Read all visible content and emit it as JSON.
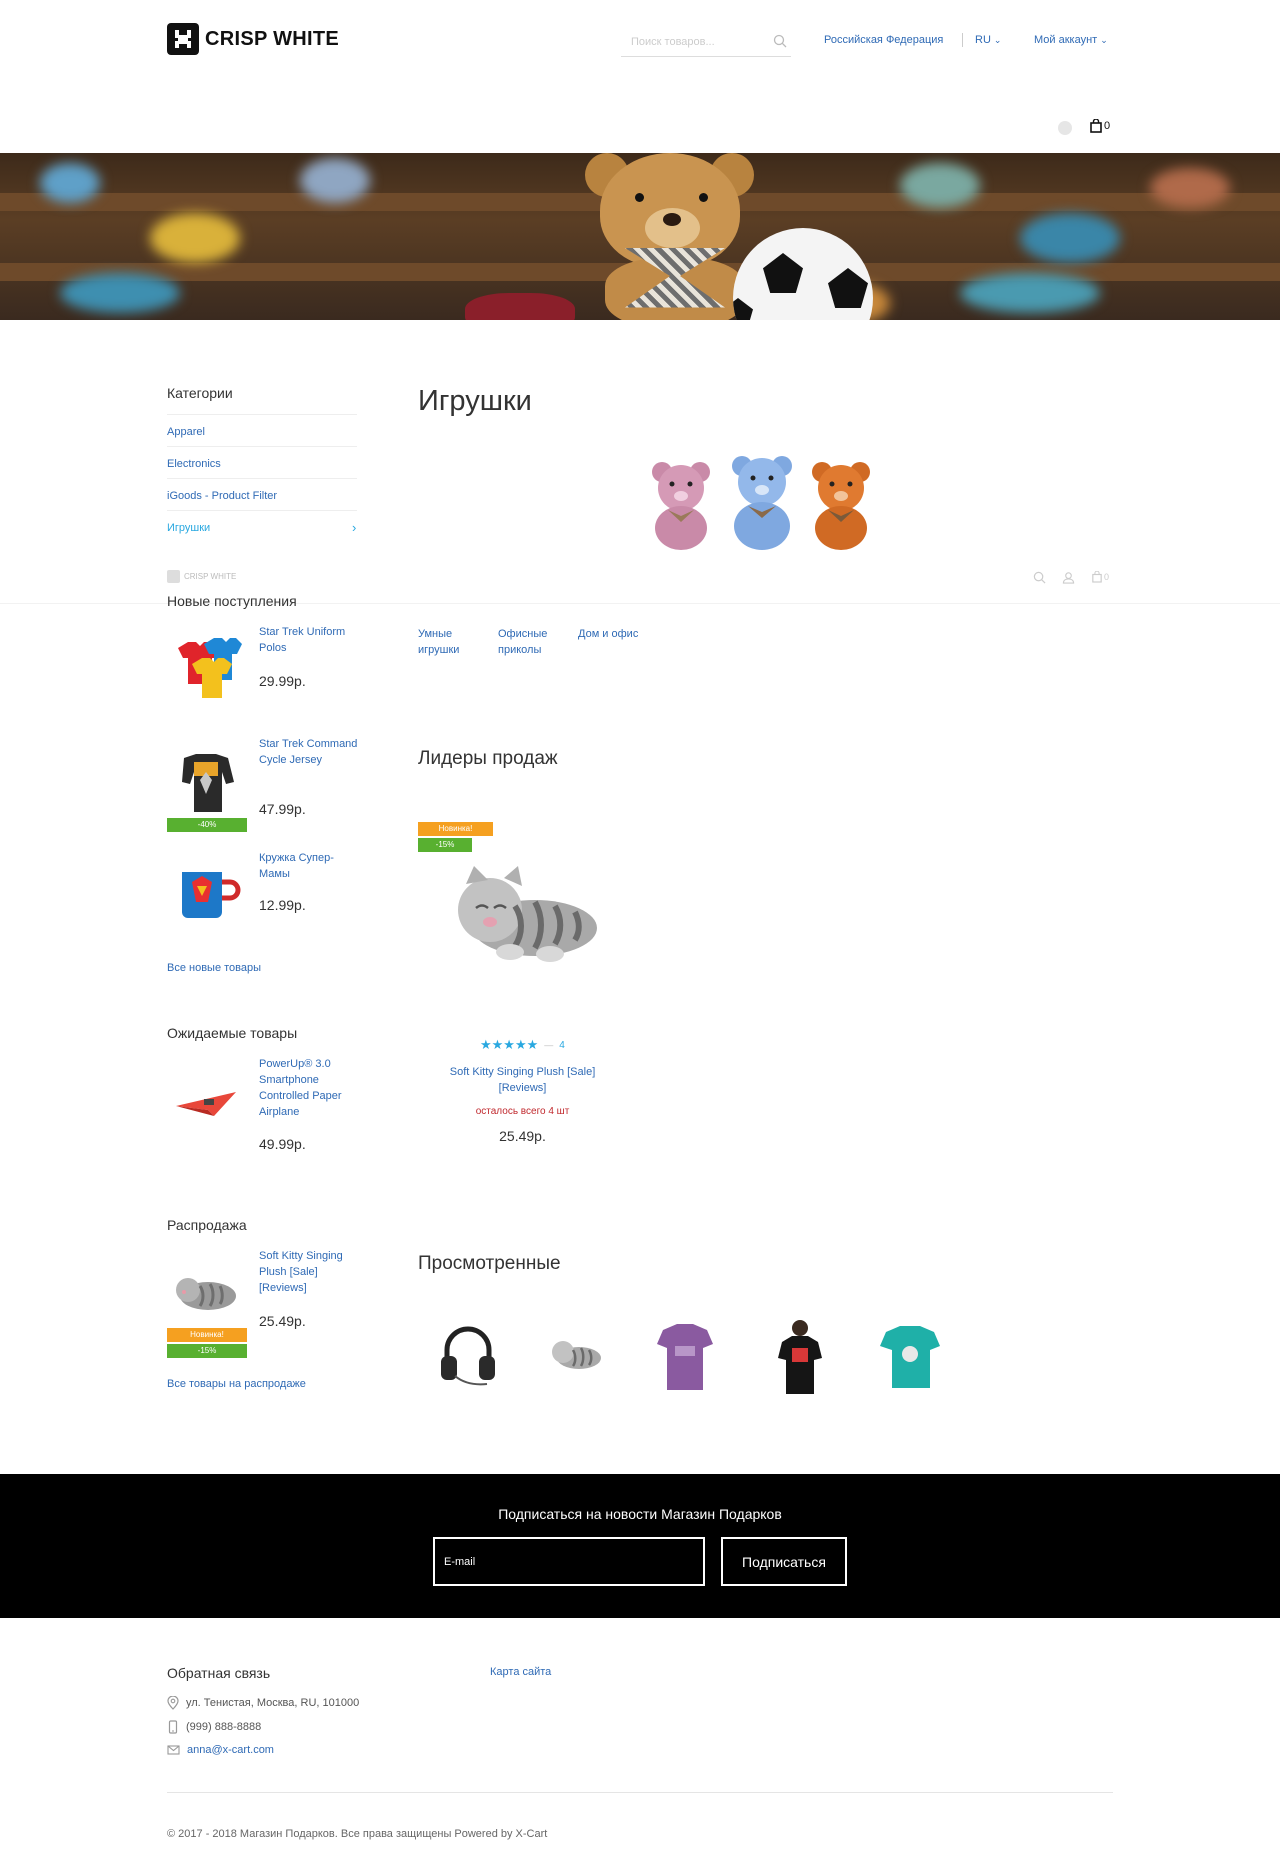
{
  "header": {
    "logo_text": "CRISP WHITE",
    "search_placeholder": "Поиск товаров...",
    "country": "Российская Федерация",
    "language": "RU",
    "account": "Мой аккаунт",
    "cart_count": "0"
  },
  "sidebar": {
    "categories_title": "Категории",
    "categories": [
      "Apparel",
      "Electronics",
      "iGoods - Product Filter",
      "Игрушки"
    ],
    "mini_logo": "CRISP WHITE",
    "new_arrivals": {
      "title": "Новые поступления",
      "items": [
        {
          "name": "Star Trek Uniform Polos",
          "price": "29.99р."
        },
        {
          "name": "Star Trek Command Cycle Jersey",
          "price": "47.99р.",
          "badge": "-40%"
        },
        {
          "name": "Кружка Супер-Мамы",
          "price": "12.99р."
        }
      ],
      "all_link": "Все новые товары"
    },
    "coming_soon": {
      "title": "Ожидаемые товары",
      "items": [
        {
          "name": "PowerUp® 3.0 Smartphone Controlled Paper Airplane",
          "price": "49.99р."
        }
      ]
    },
    "sale": {
      "title": "Распродажа",
      "items": [
        {
          "name": "Soft Kitty Singing Plush [Sale] [Reviews]",
          "price": "25.49р.",
          "badge_new": "Новинка!",
          "badge_discount": "-15%"
        }
      ],
      "all_link": "Все товары на распродаже"
    }
  },
  "main": {
    "title": "Игрушки",
    "mini_cart_count": "0",
    "subcategories": [
      "Умные игрушки",
      "Офисные приколы",
      "Дом и офис"
    ],
    "bestsellers_title": "Лидеры продаж",
    "bestseller": {
      "badge_new": "Новинка!",
      "badge_discount": "-15%",
      "rating": 5,
      "reviews_count": "4",
      "name": "Soft Kitty Singing Plush [Sale] [Reviews]",
      "stock": "осталось всего 4 шт",
      "price": "25.49р."
    },
    "viewed_title": "Просмотренные",
    "viewed_items": [
      "headphones",
      "kitty-plush",
      "purple-tshirt",
      "woman-tshirt",
      "teal-tshirt"
    ]
  },
  "newsletter": {
    "title": "Подписаться на новости Магазин Подарков",
    "email_placeholder": "E-mail",
    "button": "Подписаться"
  },
  "footer": {
    "contact_title": "Обратная связь",
    "address": "ул. Тенистая, Москва, RU, 101000",
    "phone": "(999) 888-8888",
    "email": "anna@x-cart.com",
    "sitemap": "Карта сайта",
    "copyright": "© 2017 - 2018 Магазин Подарков. Все права защищены Powered by X-Cart"
  },
  "colors": {
    "link": "#2f6ab5",
    "accent": "#29a8e0",
    "badge_green": "#58b030",
    "badge_orange": "#f5a020",
    "stock_red": "#c0282d"
  }
}
